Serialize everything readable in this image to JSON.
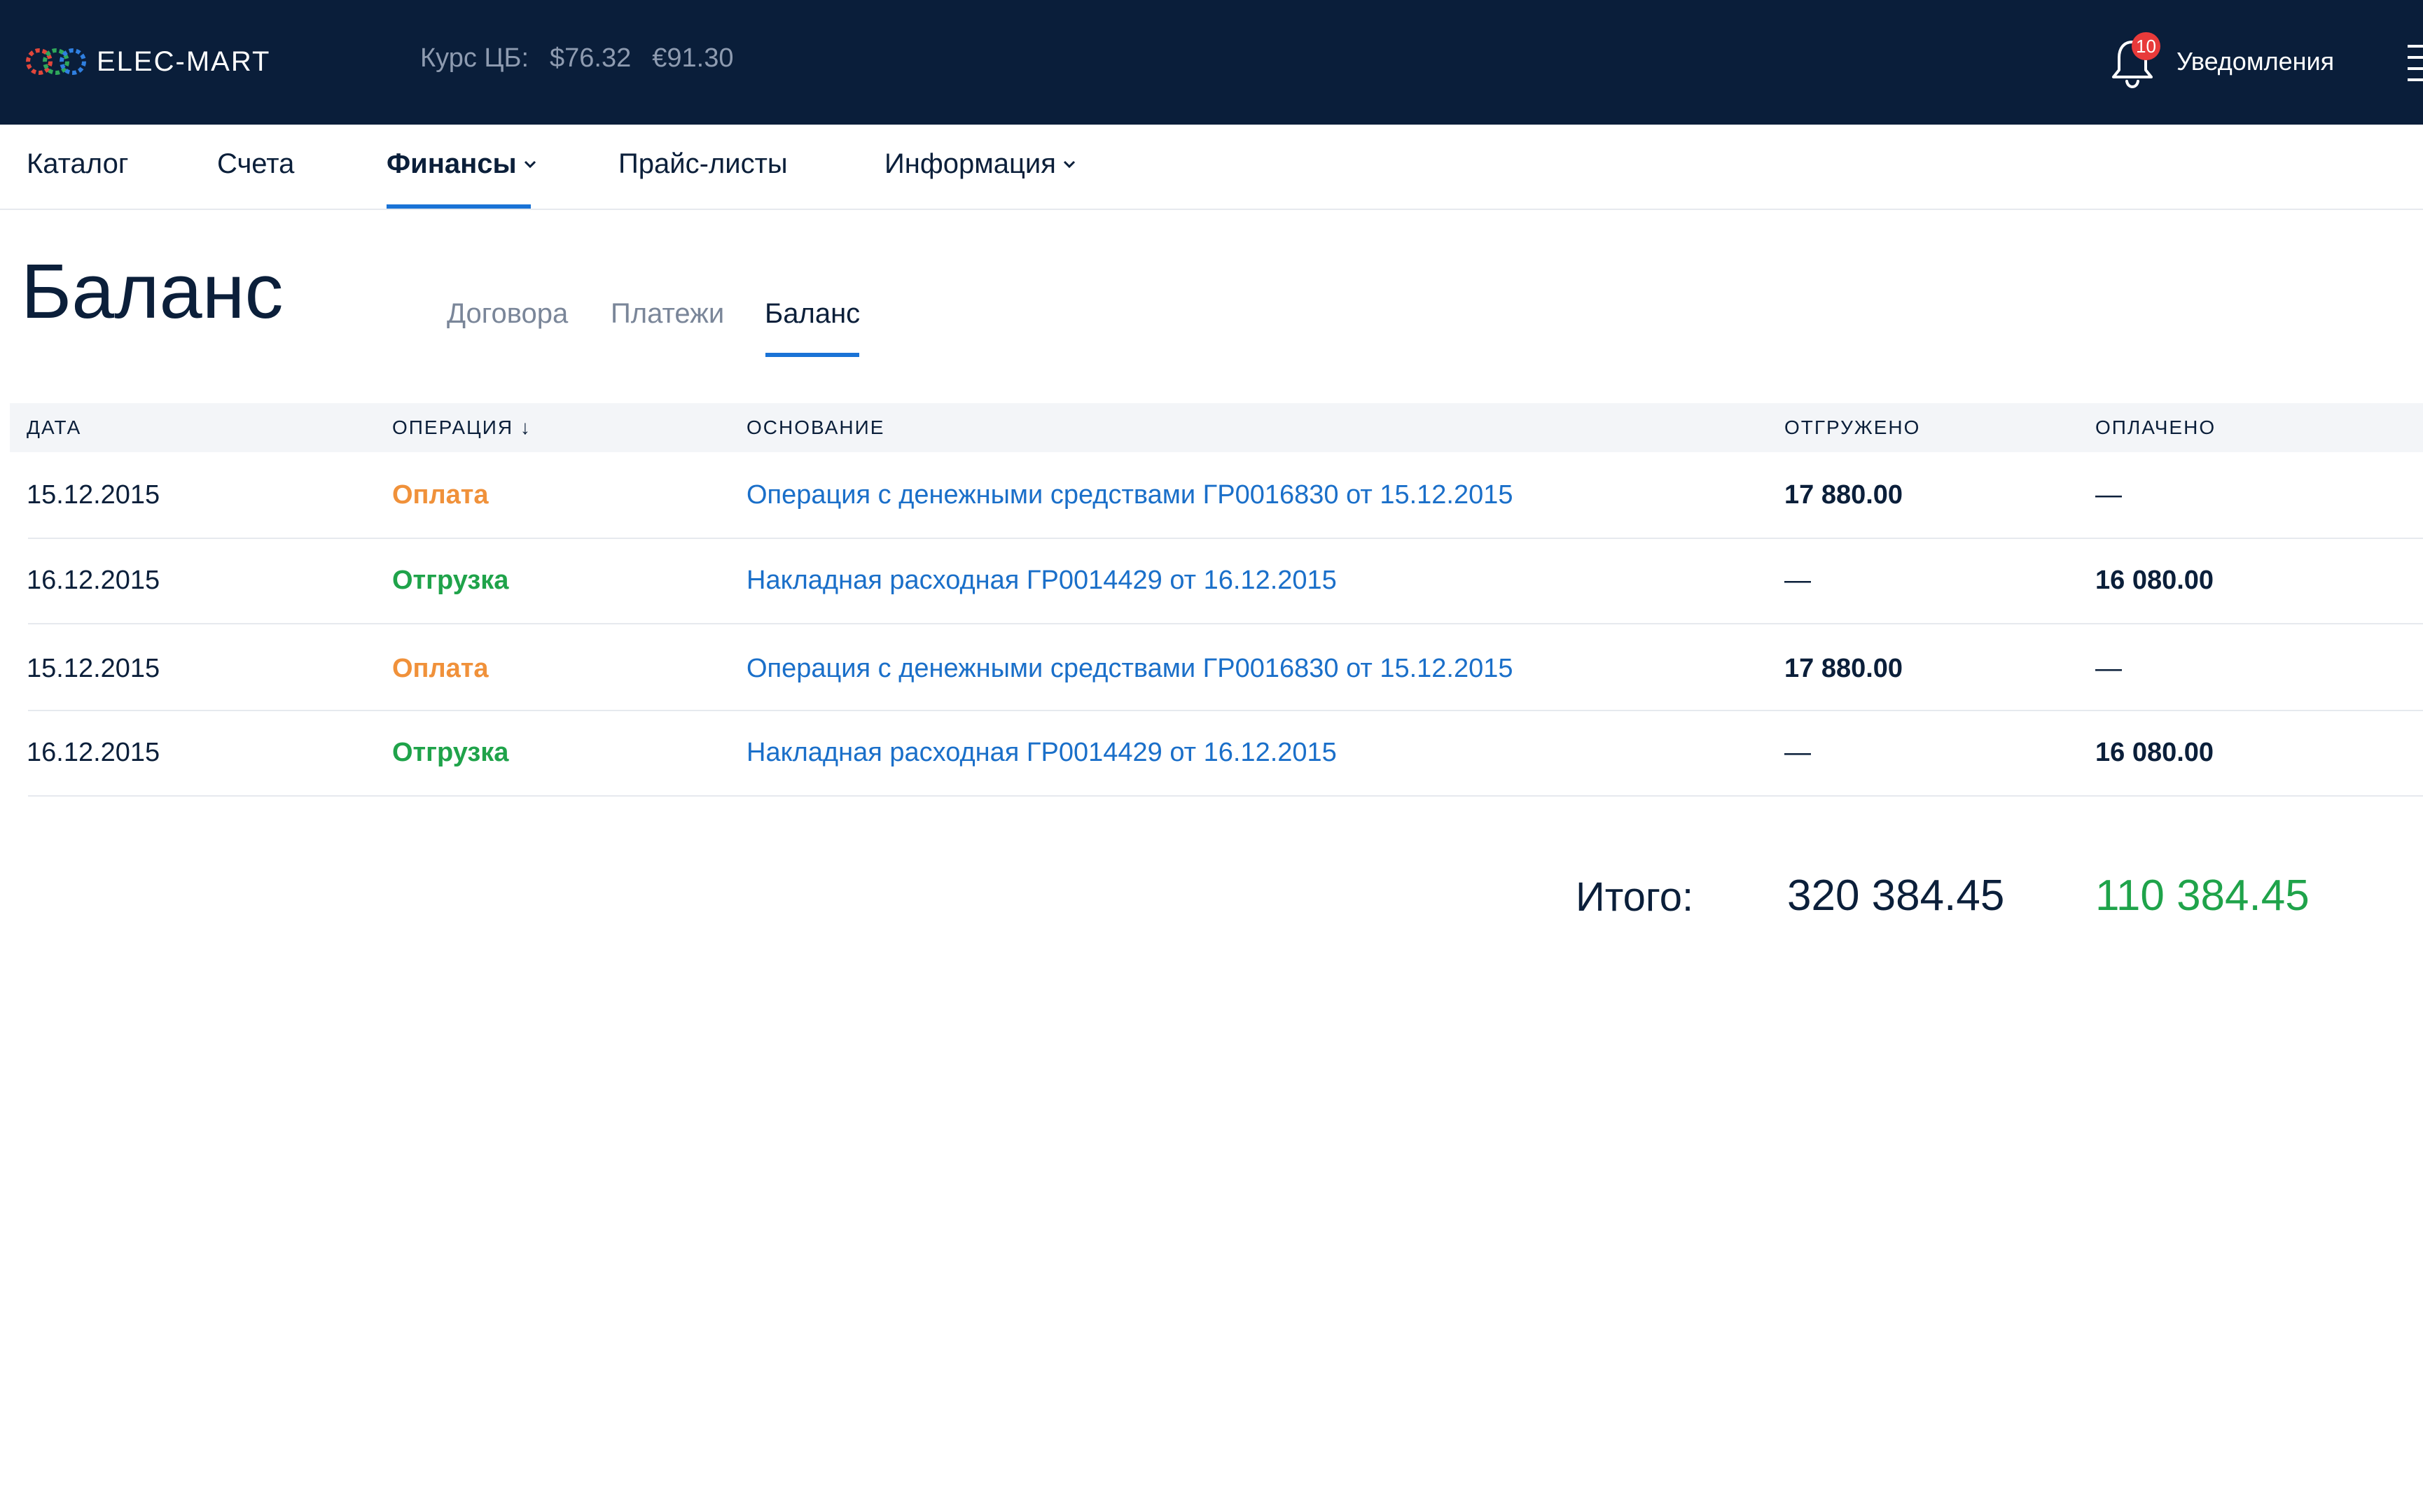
{
  "header": {
    "logo_text": "ELEC-MART",
    "rate_label": "Курс ЦБ:",
    "rate_usd": "$76.32",
    "rate_eur": "€91.30",
    "notifications_count": "10",
    "notifications_label": "Уведомления",
    "icons": [
      "logo-gears-icon",
      "bell-icon",
      "menu-icon"
    ]
  },
  "nav": {
    "items": [
      {
        "label": "Каталог",
        "has_dropdown": false,
        "active": false
      },
      {
        "label": "Счета",
        "has_dropdown": false,
        "active": false
      },
      {
        "label": "Финансы",
        "has_dropdown": true,
        "active": true
      },
      {
        "label": "Прайс-листы",
        "has_dropdown": false,
        "active": false
      },
      {
        "label": "Информация",
        "has_dropdown": true,
        "active": false
      }
    ]
  },
  "page": {
    "title": "Баланс",
    "tabs": [
      {
        "label": "Договора",
        "active": false
      },
      {
        "label": "Платежи",
        "active": false
      },
      {
        "label": "Баланс",
        "active": true
      }
    ]
  },
  "table": {
    "columns": [
      "ДАТА",
      "ОПЕРАЦИЯ ↓",
      "ОСНОВАНИЕ",
      "ОТГРУЖЕНО",
      "ОПЛАЧЕНО"
    ],
    "rows": [
      {
        "date": "15.12.2015",
        "operation": "Оплата",
        "basis": "Операция с денежными средствами ГР0016830 от 15.12.2015",
        "shipped": "17 880.00",
        "paid": "—"
      },
      {
        "date": "16.12.2015",
        "operation": "Отгрузка",
        "basis": "Накладная расходная ГР0014429 от 16.12.2015",
        "shipped": "—",
        "paid": "16 080.00"
      },
      {
        "date": "15.12.2015",
        "operation": "Оплата",
        "basis": "Операция с денежными средствами ГР0016830 от 15.12.2015",
        "shipped": "17 880.00",
        "paid": "—"
      },
      {
        "date": "16.12.2015",
        "operation": "Отгрузка",
        "basis": "Накладная расходная ГР0014429 от 16.12.2015",
        "shipped": "—",
        "paid": "16 080.00"
      }
    ]
  },
  "totals": {
    "label": "Итого:",
    "shipped": "320 384.45",
    "paid": "110 384.45"
  },
  "colors": {
    "header_bg": "#0a1e3a",
    "accent": "#1a73d6",
    "payment": "#f0913a",
    "shipment": "#1fa34a",
    "link": "#1a6fc9",
    "badge": "#e83a3a"
  }
}
